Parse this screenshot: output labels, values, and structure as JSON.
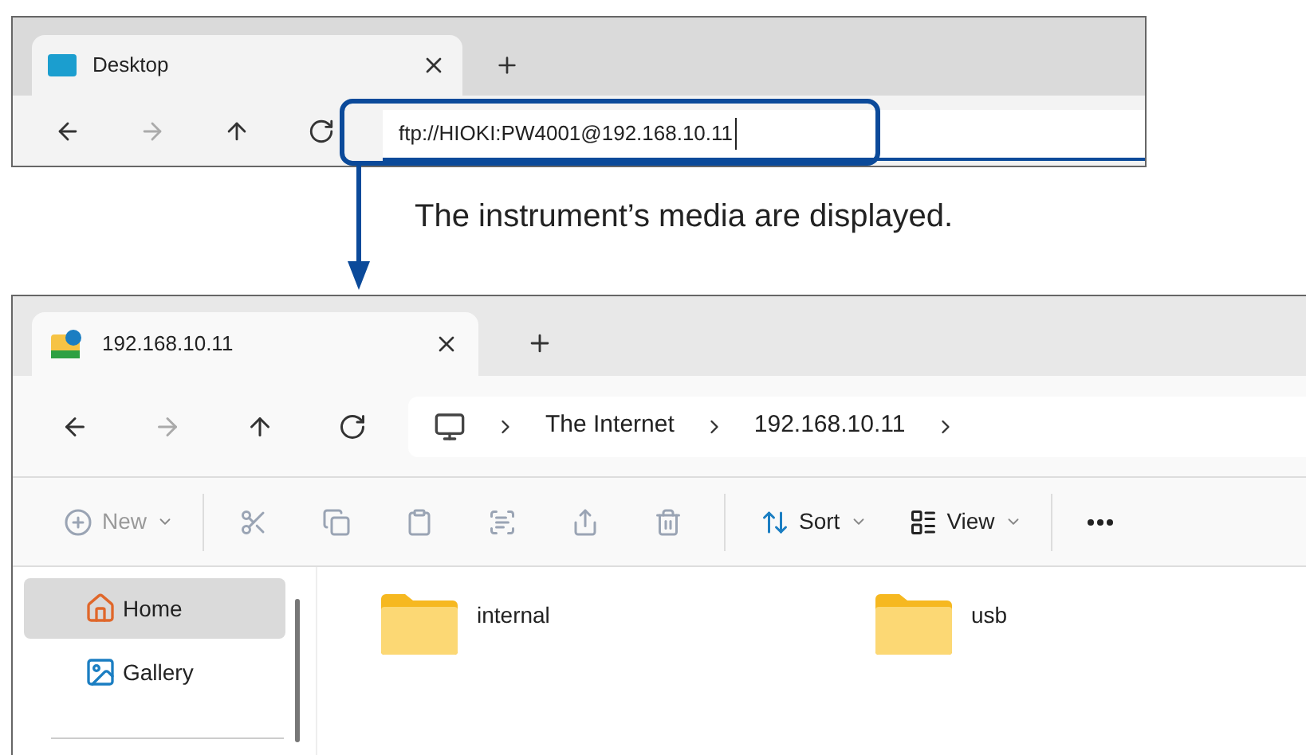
{
  "top_window": {
    "tab": {
      "title": "Desktop",
      "selected": true
    },
    "address": {
      "value": "ftp://HIOKI:PW4001@192.168.10.11"
    }
  },
  "caption": "The instrument’s media are displayed.",
  "explorer": {
    "tab": {
      "title": "192.168.10.11",
      "selected": true
    },
    "breadcrumb": [
      "The Internet",
      "192.168.10.11"
    ],
    "toolbar": [
      {
        "kind": "new",
        "label": "New",
        "disabled": true
      },
      {
        "kind": "cut",
        "disabled": true
      },
      {
        "kind": "copy",
        "disabled": true
      },
      {
        "kind": "paste",
        "disabled": true
      },
      {
        "kind": "rename",
        "disabled": true
      },
      {
        "kind": "share",
        "disabled": true
      },
      {
        "kind": "delete",
        "disabled": true
      },
      {
        "kind": "sort",
        "label": "Sort",
        "disabled": false
      },
      {
        "kind": "view",
        "label": "View",
        "disabled": false
      },
      {
        "kind": "more",
        "disabled": false
      }
    ],
    "sidebar": [
      {
        "kind": "home",
        "label": "Home",
        "selected": true
      },
      {
        "kind": "gallery",
        "label": "Gallery",
        "selected": false
      }
    ],
    "files": [
      {
        "name": "internal"
      },
      {
        "name": "usb"
      }
    ]
  }
}
